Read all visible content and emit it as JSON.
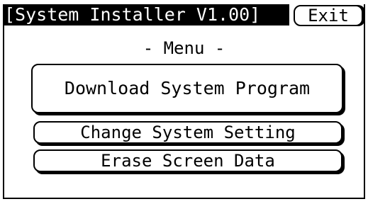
{
  "title_bar": {
    "label": "[System Installer V1.00]"
  },
  "exit_button": {
    "label": "Exit"
  },
  "menu": {
    "heading": "- Menu -",
    "items": [
      {
        "label": "Download System Program"
      },
      {
        "label": "Change System Setting"
      },
      {
        "label": "Erase Screen Data"
      }
    ]
  },
  "colors": {
    "background": "#ffffff",
    "foreground": "#000000",
    "title_bar_background": "#000000",
    "title_bar_text": "#ffffff"
  }
}
